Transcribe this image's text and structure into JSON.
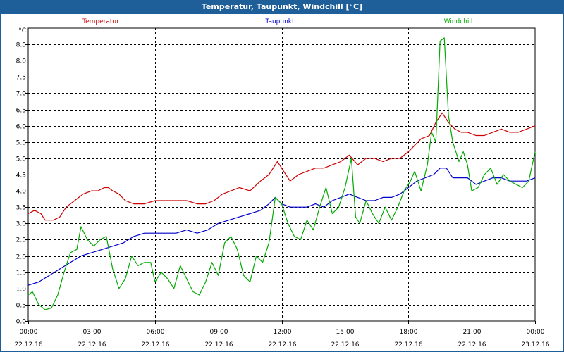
{
  "window": {
    "title": "Temperatur, Taupunkt, Windchill [°C]"
  },
  "chart_data": {
    "type": "line",
    "title": "Temperatur, Taupunkt, Windchill [°C]",
    "ylabel": "°C",
    "ylim": [
      0.0,
      9.0
    ],
    "yticks": [
      "0.0",
      "0.5",
      "1.0",
      "1.5",
      "2.0",
      "2.5",
      "3.0",
      "3.5",
      "4.0",
      "4.5",
      "5.0",
      "5.5",
      "6.0",
      "6.5",
      "7.0",
      "7.5",
      "8.0",
      "8.5"
    ],
    "xlim_hours": [
      0,
      24
    ],
    "xticks": [
      {
        "hour": 0,
        "time": "00:00",
        "date": "22.12.16"
      },
      {
        "hour": 3,
        "time": "03:00",
        "date": "22.12.16"
      },
      {
        "hour": 6,
        "time": "06:00",
        "date": "22.12.16"
      },
      {
        "hour": 9,
        "time": "09:00",
        "date": "22.12.16"
      },
      {
        "hour": 12,
        "time": "12:00",
        "date": "22.12.16"
      },
      {
        "hour": 15,
        "time": "15:00",
        "date": "22.12.16"
      },
      {
        "hour": 18,
        "time": "18:00",
        "date": "22.12.16"
      },
      {
        "hour": 21,
        "time": "21:00",
        "date": "22.12.16"
      },
      {
        "hour": 24,
        "time": "00:00",
        "date": "23.12.16"
      }
    ],
    "grid": true,
    "legend_position": "top",
    "series": [
      {
        "name": "Temperatur",
        "color": "#cc0000",
        "points": [
          [
            0,
            3.3
          ],
          [
            0.3,
            3.4
          ],
          [
            0.6,
            3.3
          ],
          [
            0.8,
            3.1
          ],
          [
            1.2,
            3.1
          ],
          [
            1.5,
            3.2
          ],
          [
            1.8,
            3.5
          ],
          [
            2.2,
            3.7
          ],
          [
            2.6,
            3.9
          ],
          [
            3.0,
            4.0
          ],
          [
            3.3,
            4.0
          ],
          [
            3.6,
            4.1
          ],
          [
            3.8,
            4.1
          ],
          [
            4.0,
            4.0
          ],
          [
            4.3,
            3.9
          ],
          [
            4.6,
            3.7
          ],
          [
            5.0,
            3.6
          ],
          [
            5.5,
            3.6
          ],
          [
            6.0,
            3.7
          ],
          [
            6.5,
            3.7
          ],
          [
            7.0,
            3.7
          ],
          [
            7.5,
            3.7
          ],
          [
            8.0,
            3.6
          ],
          [
            8.4,
            3.6
          ],
          [
            8.8,
            3.7
          ],
          [
            9.2,
            3.9
          ],
          [
            9.6,
            4.0
          ],
          [
            10.0,
            4.1
          ],
          [
            10.5,
            4.0
          ],
          [
            11.0,
            4.3
          ],
          [
            11.4,
            4.5
          ],
          [
            11.8,
            4.9
          ],
          [
            12.1,
            4.6
          ],
          [
            12.4,
            4.3
          ],
          [
            12.8,
            4.5
          ],
          [
            13.2,
            4.6
          ],
          [
            13.6,
            4.7
          ],
          [
            14.0,
            4.7
          ],
          [
            14.4,
            4.8
          ],
          [
            14.8,
            4.9
          ],
          [
            15.2,
            5.1
          ],
          [
            15.6,
            4.8
          ],
          [
            16.0,
            5.0
          ],
          [
            16.4,
            5.0
          ],
          [
            16.8,
            4.9
          ],
          [
            17.2,
            5.0
          ],
          [
            17.6,
            5.0
          ],
          [
            18.0,
            5.2
          ],
          [
            18.3,
            5.4
          ],
          [
            18.6,
            5.6
          ],
          [
            19.0,
            5.7
          ],
          [
            19.3,
            6.1
          ],
          [
            19.6,
            6.4
          ],
          [
            19.9,
            6.1
          ],
          [
            20.2,
            5.9
          ],
          [
            20.5,
            5.8
          ],
          [
            20.8,
            5.8
          ],
          [
            21.2,
            5.7
          ],
          [
            21.6,
            5.7
          ],
          [
            22.0,
            5.8
          ],
          [
            22.4,
            5.9
          ],
          [
            22.8,
            5.8
          ],
          [
            23.2,
            5.8
          ],
          [
            23.6,
            5.9
          ],
          [
            24.0,
            6.0
          ]
        ]
      },
      {
        "name": "Taupunkt",
        "color": "#0000cc",
        "points": [
          [
            0,
            1.1
          ],
          [
            0.5,
            1.2
          ],
          [
            1.0,
            1.4
          ],
          [
            1.5,
            1.6
          ],
          [
            2.0,
            1.8
          ],
          [
            2.5,
            2.0
          ],
          [
            3.0,
            2.1
          ],
          [
            3.5,
            2.2
          ],
          [
            4.0,
            2.3
          ],
          [
            4.5,
            2.4
          ],
          [
            5.0,
            2.6
          ],
          [
            5.5,
            2.7
          ],
          [
            6.0,
            2.7
          ],
          [
            6.5,
            2.7
          ],
          [
            7.0,
            2.7
          ],
          [
            7.5,
            2.8
          ],
          [
            8.0,
            2.7
          ],
          [
            8.5,
            2.8
          ],
          [
            9.0,
            3.0
          ],
          [
            9.5,
            3.1
          ],
          [
            10.0,
            3.2
          ],
          [
            10.5,
            3.3
          ],
          [
            11.0,
            3.4
          ],
          [
            11.4,
            3.6
          ],
          [
            11.7,
            3.8
          ],
          [
            12.0,
            3.6
          ],
          [
            12.4,
            3.5
          ],
          [
            12.8,
            3.5
          ],
          [
            13.2,
            3.5
          ],
          [
            13.6,
            3.6
          ],
          [
            14.0,
            3.5
          ],
          [
            14.4,
            3.7
          ],
          [
            14.8,
            3.8
          ],
          [
            15.2,
            3.9
          ],
          [
            15.6,
            3.8
          ],
          [
            16.0,
            3.7
          ],
          [
            16.4,
            3.7
          ],
          [
            16.8,
            3.8
          ],
          [
            17.2,
            3.8
          ],
          [
            17.6,
            3.9
          ],
          [
            18.0,
            4.1
          ],
          [
            18.4,
            4.3
          ],
          [
            18.8,
            4.4
          ],
          [
            19.2,
            4.5
          ],
          [
            19.5,
            4.7
          ],
          [
            19.8,
            4.7
          ],
          [
            20.1,
            4.4
          ],
          [
            20.4,
            4.4
          ],
          [
            20.8,
            4.4
          ],
          [
            21.2,
            4.2
          ],
          [
            21.6,
            4.3
          ],
          [
            22.0,
            4.4
          ],
          [
            22.4,
            4.4
          ],
          [
            22.8,
            4.3
          ],
          [
            23.2,
            4.3
          ],
          [
            23.6,
            4.3
          ],
          [
            24.0,
            4.4
          ]
        ]
      },
      {
        "name": "Windchill",
        "color": "#00aa00",
        "points": [
          [
            0,
            0.8
          ],
          [
            0.2,
            0.9
          ],
          [
            0.5,
            0.5
          ],
          [
            0.8,
            0.35
          ],
          [
            1.1,
            0.4
          ],
          [
            1.4,
            0.8
          ],
          [
            1.7,
            1.5
          ],
          [
            2.0,
            2.1
          ],
          [
            2.3,
            2.2
          ],
          [
            2.5,
            2.9
          ],
          [
            2.8,
            2.5
          ],
          [
            3.1,
            2.3
          ],
          [
            3.4,
            2.5
          ],
          [
            3.7,
            2.6
          ],
          [
            4.0,
            1.6
          ],
          [
            4.3,
            1.0
          ],
          [
            4.6,
            1.3
          ],
          [
            4.9,
            2.0
          ],
          [
            5.2,
            1.7
          ],
          [
            5.5,
            1.8
          ],
          [
            5.8,
            1.8
          ],
          [
            6.0,
            1.2
          ],
          [
            6.3,
            1.5
          ],
          [
            6.6,
            1.3
          ],
          [
            6.9,
            1.0
          ],
          [
            7.2,
            1.7
          ],
          [
            7.5,
            1.3
          ],
          [
            7.8,
            0.9
          ],
          [
            8.1,
            0.8
          ],
          [
            8.4,
            1.2
          ],
          [
            8.7,
            1.8
          ],
          [
            9.0,
            1.4
          ],
          [
            9.3,
            2.4
          ],
          [
            9.6,
            2.6
          ],
          [
            9.9,
            2.2
          ],
          [
            10.2,
            1.4
          ],
          [
            10.5,
            1.2
          ],
          [
            10.8,
            2.0
          ],
          [
            11.1,
            1.8
          ],
          [
            11.4,
            2.4
          ],
          [
            11.7,
            3.8
          ],
          [
            12.0,
            3.6
          ],
          [
            12.3,
            3.0
          ],
          [
            12.6,
            2.6
          ],
          [
            12.9,
            2.5
          ],
          [
            13.2,
            3.1
          ],
          [
            13.5,
            2.8
          ],
          [
            13.8,
            3.5
          ],
          [
            14.1,
            4.1
          ],
          [
            14.4,
            3.3
          ],
          [
            14.7,
            3.5
          ],
          [
            15.0,
            4.1
          ],
          [
            15.3,
            5.0
          ],
          [
            15.5,
            3.2
          ],
          [
            15.7,
            3.0
          ],
          [
            16.0,
            3.7
          ],
          [
            16.3,
            3.3
          ],
          [
            16.6,
            3.0
          ],
          [
            16.9,
            3.5
          ],
          [
            17.2,
            3.1
          ],
          [
            17.5,
            3.5
          ],
          [
            17.8,
            4.0
          ],
          [
            18.1,
            4.3
          ],
          [
            18.3,
            4.6
          ],
          [
            18.6,
            4.0
          ],
          [
            18.9,
            4.8
          ],
          [
            19.1,
            5.8
          ],
          [
            19.3,
            5.5
          ],
          [
            19.5,
            8.6
          ],
          [
            19.7,
            8.7
          ],
          [
            19.9,
            6.3
          ],
          [
            20.1,
            5.5
          ],
          [
            20.4,
            4.9
          ],
          [
            20.6,
            5.2
          ],
          [
            20.8,
            4.8
          ],
          [
            21.0,
            4.0
          ],
          [
            21.3,
            4.1
          ],
          [
            21.6,
            4.5
          ],
          [
            21.9,
            4.7
          ],
          [
            22.2,
            4.2
          ],
          [
            22.5,
            4.5
          ],
          [
            22.8,
            4.3
          ],
          [
            23.1,
            4.2
          ],
          [
            23.4,
            4.1
          ],
          [
            23.7,
            4.3
          ],
          [
            24.0,
            5.2
          ]
        ]
      }
    ]
  }
}
